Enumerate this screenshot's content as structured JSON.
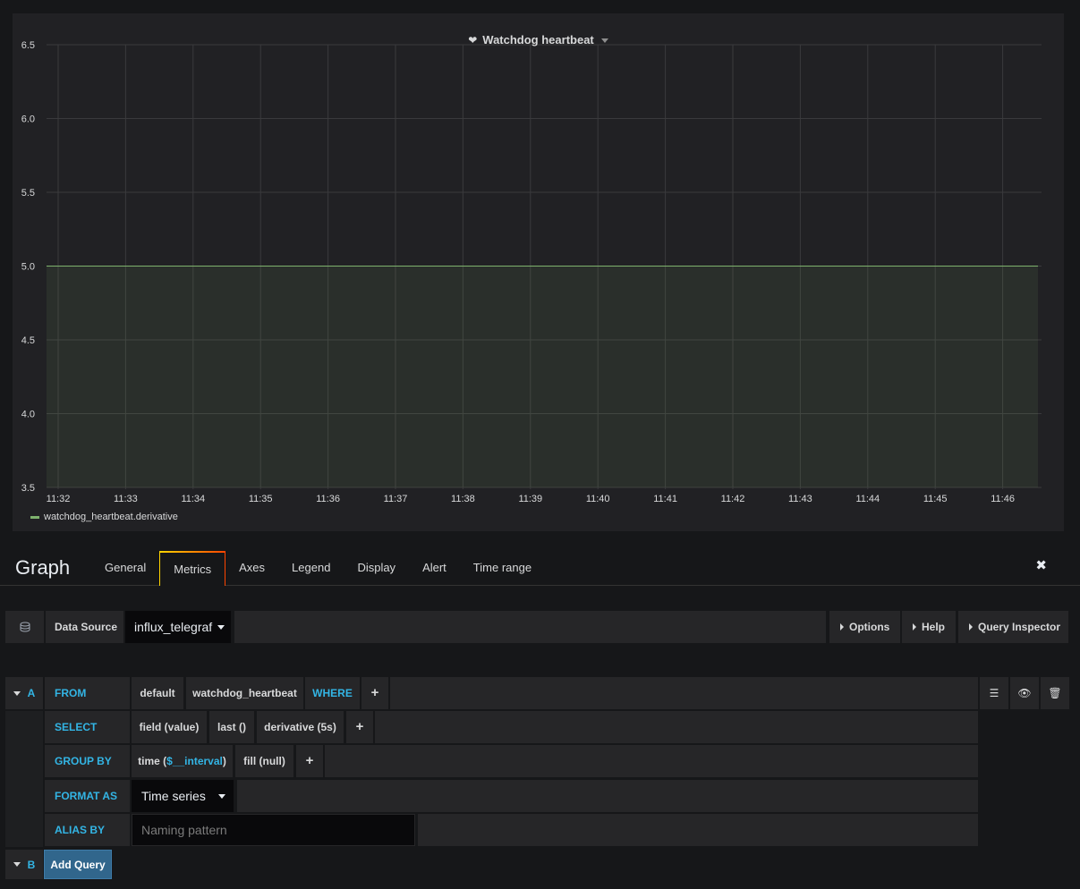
{
  "panel": {
    "title": "Watchdog heartbeat",
    "legend_series": "watchdog_heartbeat.derivative"
  },
  "chart_data": {
    "type": "area",
    "x_ticks": [
      "11:32",
      "11:33",
      "11:34",
      "11:35",
      "11:36",
      "11:37",
      "11:38",
      "11:39",
      "11:40",
      "11:41",
      "11:42",
      "11:43",
      "11:44",
      "11:45",
      "11:46"
    ],
    "y_ticks": [
      "6.5",
      "6.0",
      "5.5",
      "5.0",
      "4.5",
      "4.0",
      "3.5"
    ],
    "ylim": [
      3.5,
      6.5
    ],
    "series": [
      {
        "name": "watchdog_heartbeat.derivative",
        "x": [
          "11:32",
          "11:46"
        ],
        "values": [
          5.0,
          5.0
        ],
        "color": "#7eb26d"
      }
    ],
    "grid": true,
    "legend": "bottom-left"
  },
  "editor": {
    "title": "Graph",
    "tabs": [
      "General",
      "Metrics",
      "Axes",
      "Legend",
      "Display",
      "Alert",
      "Time range"
    ],
    "active_tab": "Metrics"
  },
  "datasource": {
    "label": "Data Source",
    "value": "influx_telegraf",
    "options_label": "Options",
    "help_label": "Help",
    "inspector_label": "Query Inspector"
  },
  "query_a": {
    "ref": "A",
    "from_label": "FROM",
    "policy": "default",
    "measurement": "watchdog_heartbeat",
    "where_label": "WHERE",
    "select_label": "SELECT",
    "select_parts": [
      "field (value)",
      "last ()",
      "derivative (5s)"
    ],
    "group_by_label": "GROUP BY",
    "group_time_prefix": "time (",
    "group_time_var": "$__interval",
    "group_time_suffix": ")",
    "fill": "fill (null)",
    "format_label": "FORMAT AS",
    "format_value": "Time series",
    "alias_label": "ALIAS BY",
    "alias_placeholder": "Naming pattern",
    "plus": "+"
  },
  "query_b": {
    "ref": "B",
    "add_label": "Add Query"
  },
  "colors": {
    "accent_blue": "#33b5e5",
    "series_green": "#7eb26d",
    "primary_button": "#31668c"
  }
}
